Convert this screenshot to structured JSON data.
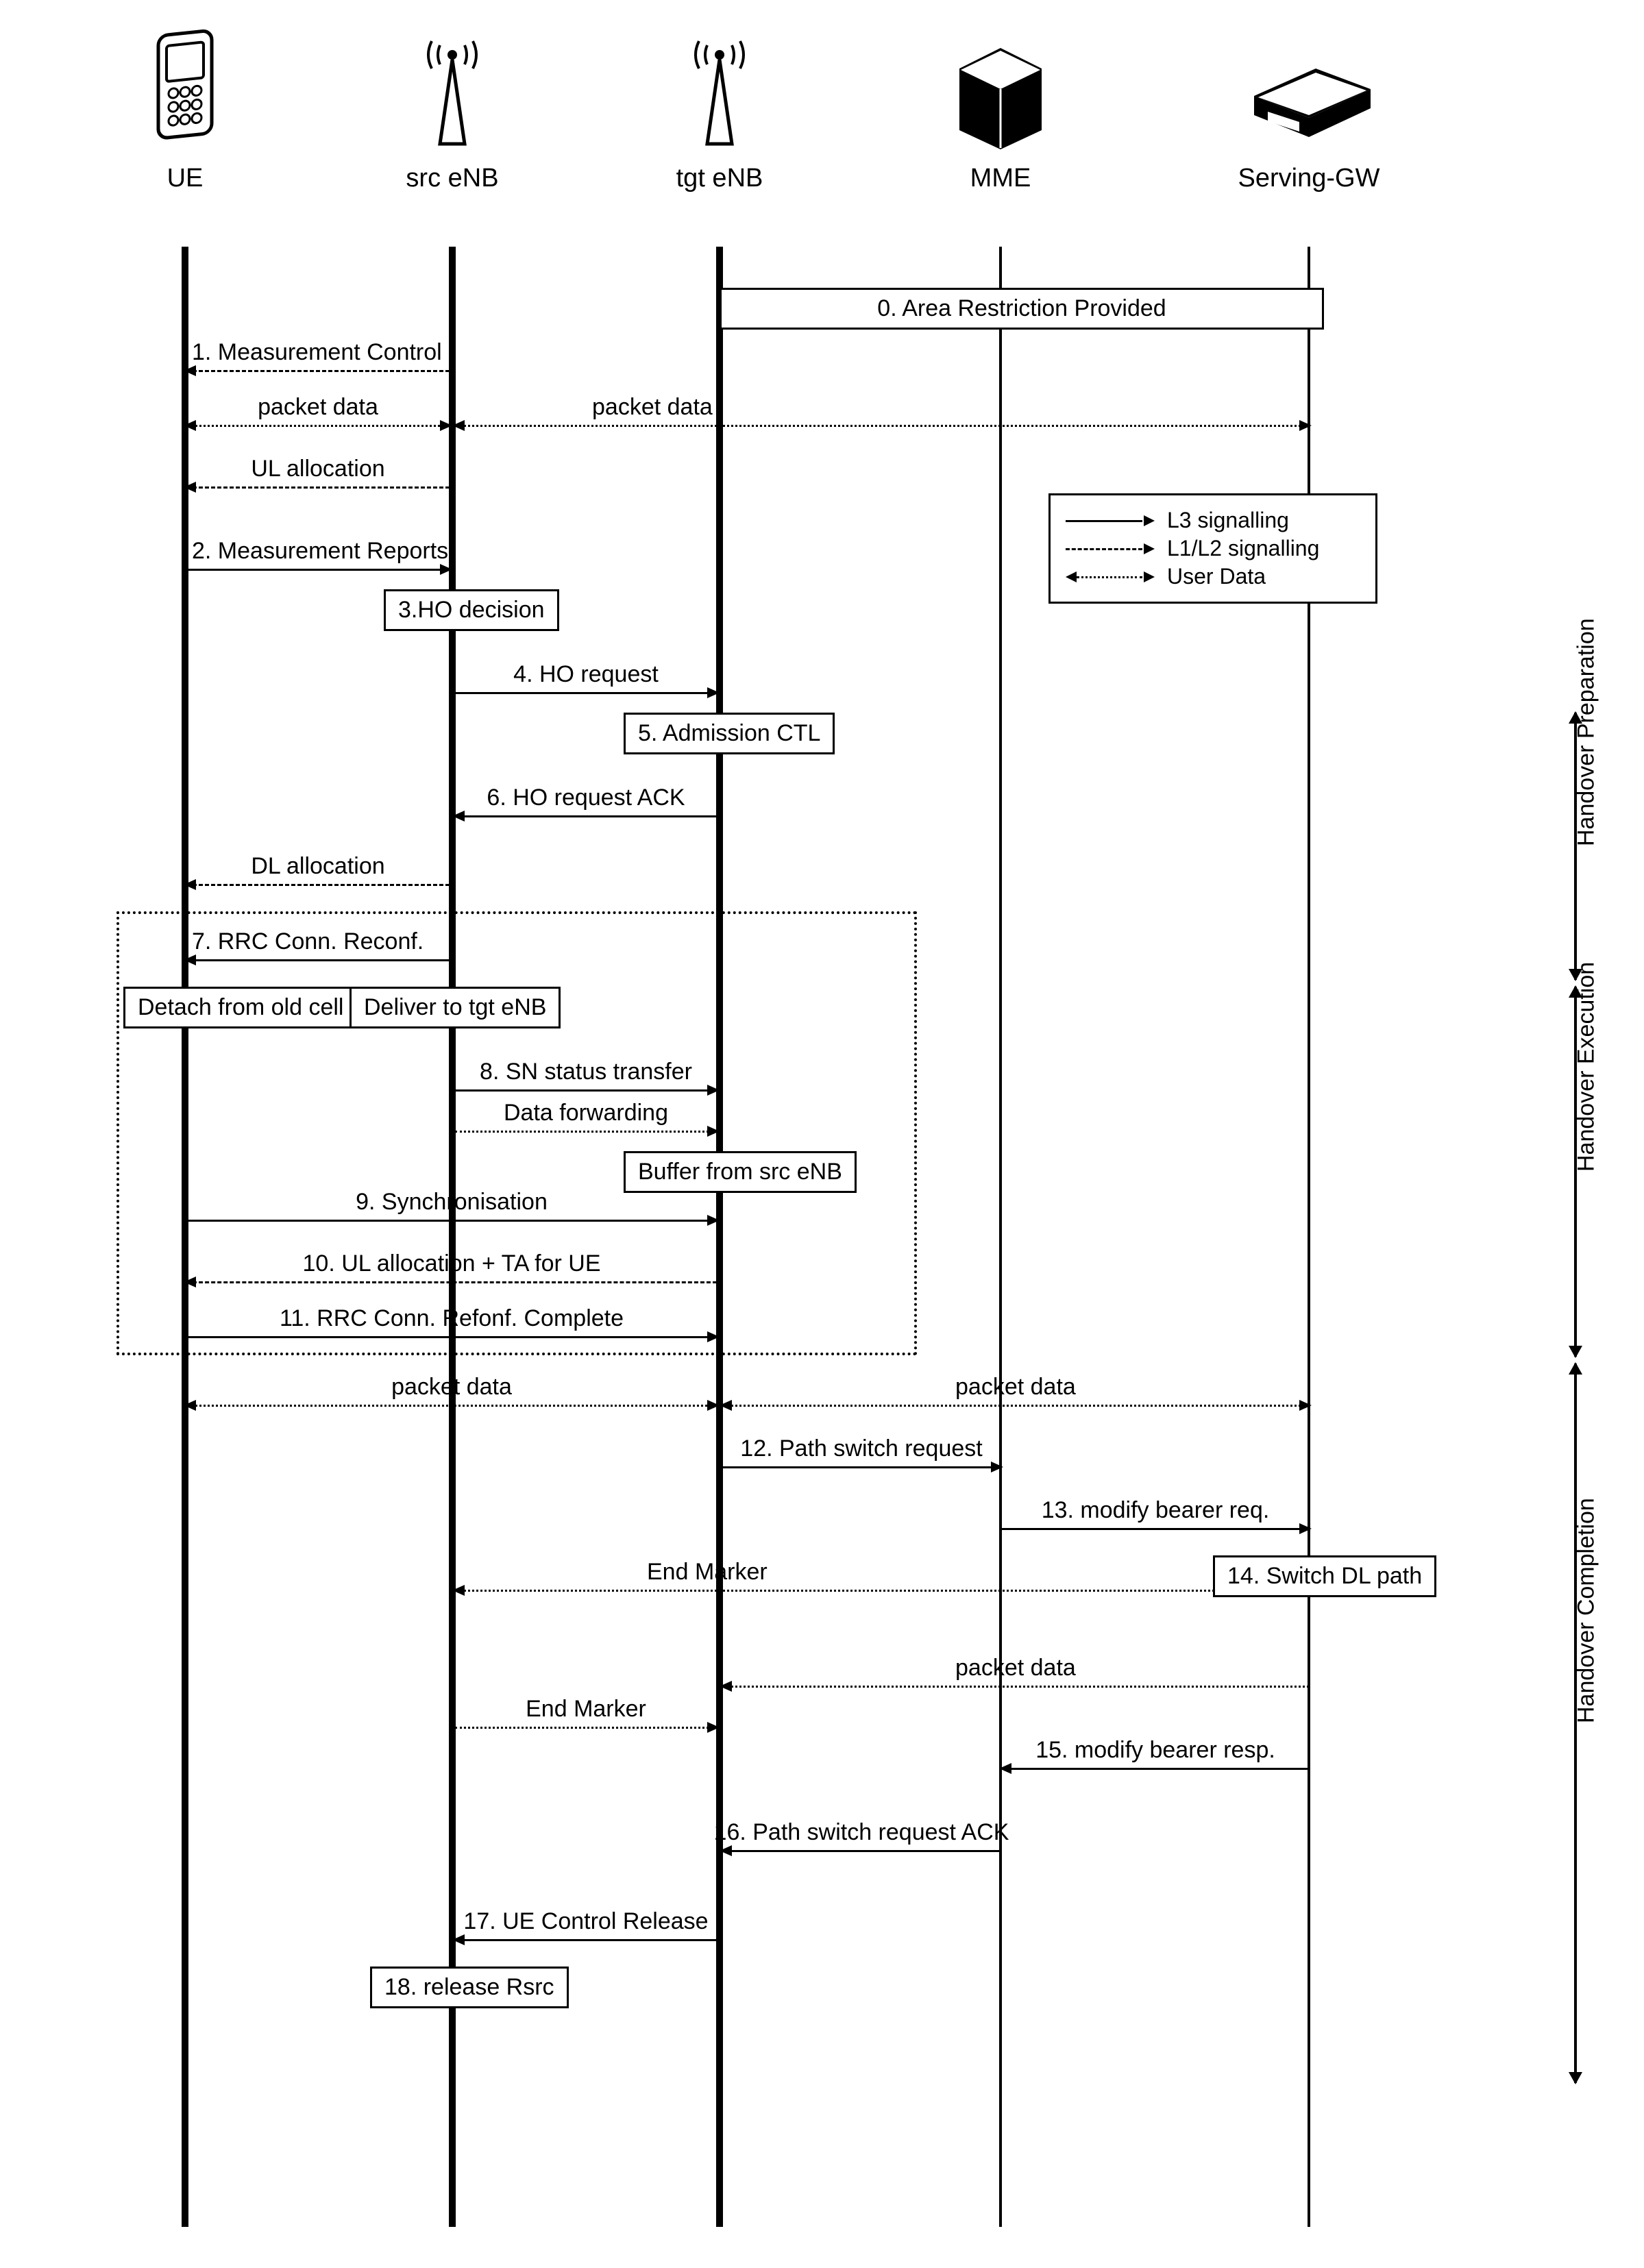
{
  "actors": {
    "ue": {
      "label": "UE"
    },
    "src": {
      "label": "src eNB"
    },
    "tgt": {
      "label": "tgt eNB"
    },
    "mme": {
      "label": "MME"
    },
    "sgw": {
      "label": "Serving-GW"
    }
  },
  "legend": {
    "l3": "L3 signalling",
    "l1l2": "L1/L2 signalling",
    "user": "User Data"
  },
  "phases": {
    "prep": "Handover Preparation",
    "exec": "Handover Execution",
    "comp": "Handover Completion"
  },
  "boxes": {
    "area_restriction": "0. Area Restriction Provided",
    "ho_decision": "3.HO decision",
    "admission_ctl": "5. Admission CTL",
    "detach_old": "Detach from old cell",
    "deliver_tgt": "Deliver to tgt eNB",
    "buffer_src": "Buffer from src eNB",
    "switch_dl": "14. Switch DL path",
    "release_rsrc": "18. release Rsrc"
  },
  "msgs": {
    "meas_ctrl": "1. Measurement Control",
    "packet_data": "packet data",
    "ul_alloc": "UL allocation",
    "meas_reports": "2. Measurement Reports",
    "ho_request": "4. HO request",
    "ho_request_ack": "6. HO request ACK",
    "dl_alloc": "DL allocation",
    "rrc_reconf": "7. RRC Conn. Reconf.",
    "sn_status": "8. SN status transfer",
    "data_fwd": "Data forwarding",
    "sync": "9. Synchronisation",
    "ul_alloc_ta": "10. UL allocation + TA for UE",
    "rrc_complete": "11. RRC Conn. Refonf. Complete",
    "path_switch_req": "12. Path switch request",
    "mod_bearer_req": "13. modify bearer req.",
    "end_marker": "End Marker",
    "mod_bearer_resp": "15. modify bearer resp.",
    "path_switch_ack": "16. Path switch request ACK",
    "ue_ctrl_release": "17. UE Control Release"
  }
}
